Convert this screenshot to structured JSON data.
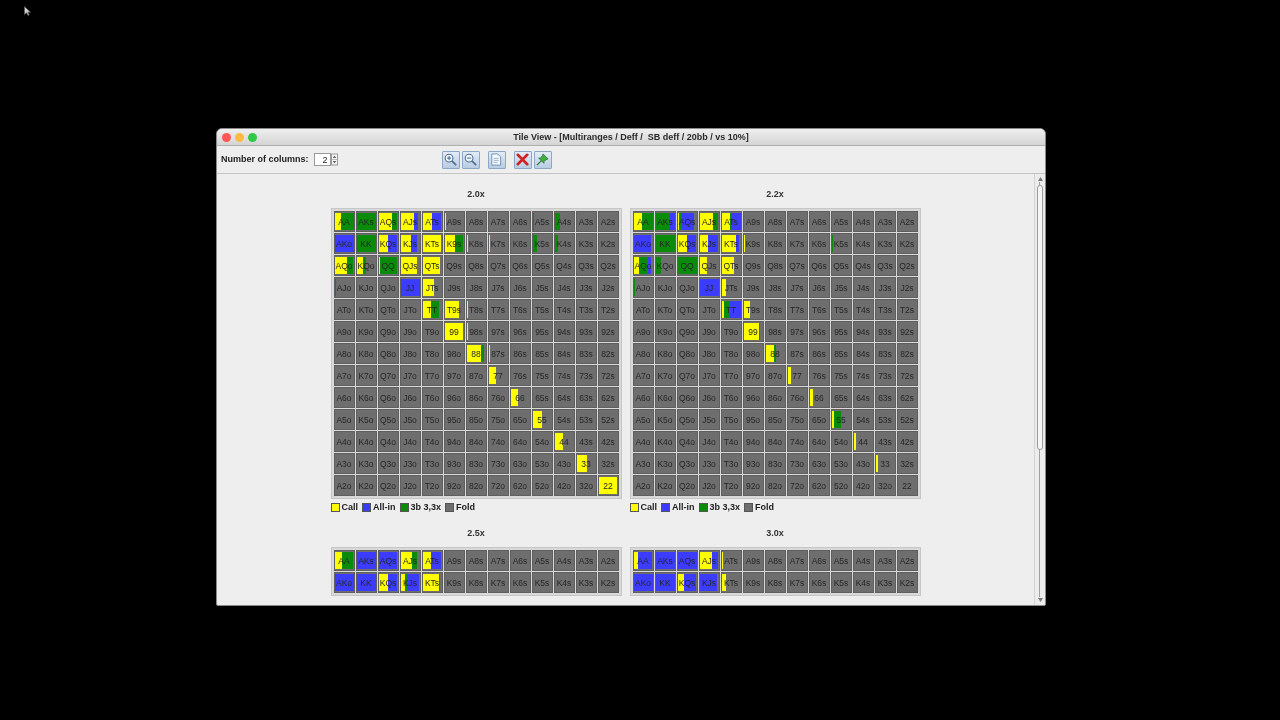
{
  "window": {
    "title": "Tile View - [Multiranges / Deff /  SB deff / 20bb / vs 10%]"
  },
  "toolbar": {
    "columns_label": "Number of columns:",
    "columns_value": "2"
  },
  "tiles": [
    {
      "title": "2.0x",
      "rows": [
        [
          {
            "label": "AA",
            "segments": [
              {
                "color": "#ffff00",
                "level": 0.35
              },
              {
                "color": "#0a8c0a",
                "level": 1
              }
            ]
          },
          {
            "label": "AKs",
            "segments": [
              {
                "color": "#0a8c0a",
                "level": 1
              }
            ]
          },
          {
            "label": "AQs",
            "segments": [
              {
                "color": "#ffff00",
                "level": 0.7
              },
              {
                "color": "#0a8c0a",
                "level": 0.95
              }
            ]
          },
          {
            "label": "AJs",
            "segments": [
              {
                "color": "#ffff00",
                "level": 0.7
              },
              {
                "color": "#3c3cff",
                "level": 0.9
              }
            ]
          },
          {
            "label": "ATs",
            "segments": [
              {
                "color": "#ffff00",
                "level": 0.5
              },
              {
                "color": "#3c3cff",
                "level": 0.95
              }
            ]
          },
          {
            "label": "A9s",
            "segments": [
              {
                "color": "#ffff00",
                "level": 0.1
              }
            ]
          },
          {
            "label": "A8s"
          },
          {
            "label": "A7s"
          },
          {
            "label": "A6s"
          },
          {
            "label": "A5s",
            "segments": [
              {
                "color": "#0a8c0a",
                "level": 0.06
              }
            ]
          },
          {
            "label": "A4s",
            "segments": [
              {
                "color": "#0a8c0a",
                "level": 0.3
              }
            ]
          },
          {
            "label": "A3s"
          },
          {
            "label": "A2s"
          }
        ],
        [
          {
            "label": "AKo",
            "segments": [
              {
                "color": "#3c3cff",
                "level": 1
              }
            ]
          },
          {
            "label": "KK",
            "segments": [
              {
                "color": "#0a8c0a",
                "level": 1
              }
            ]
          },
          {
            "label": "KQs",
            "segments": [
              {
                "color": "#ffff00",
                "level": 0.5
              },
              {
                "color": "#3c3cff",
                "level": 0.95
              }
            ]
          },
          {
            "label": "KJs",
            "segments": [
              {
                "color": "#ffff00",
                "level": 0.55
              },
              {
                "color": "#3c3cff",
                "level": 0.85
              }
            ]
          },
          {
            "label": "KTs",
            "segments": [
              {
                "color": "#ffff00",
                "level": 0.95
              }
            ]
          },
          {
            "label": "K9s",
            "segments": [
              {
                "color": "#ffff00",
                "level": 0.55
              },
              {
                "color": "#0a8c0a",
                "level": 0.95
              }
            ]
          },
          {
            "label": "K8s",
            "segments": [
              {
                "color": "#ffff00",
                "level": 0.06
              }
            ]
          },
          {
            "label": "K7s",
            "segments": [
              {
                "color": "#ffff00",
                "level": 0.04
              }
            ]
          },
          {
            "label": "K6s"
          },
          {
            "label": "K5s",
            "segments": [
              {
                "color": "#0a8c0a",
                "level": 0.25
              }
            ]
          },
          {
            "label": "K4s",
            "segments": [
              {
                "color": "#0a8c0a",
                "level": 0.2
              }
            ]
          },
          {
            "label": "K3s"
          },
          {
            "label": "K2s"
          }
        ],
        [
          {
            "label": "AQo",
            "segments": [
              {
                "color": "#ffff00",
                "level": 0.65
              },
              {
                "color": "#0a8c0a",
                "level": 0.95
              }
            ]
          },
          {
            "label": "KQo",
            "segments": [
              {
                "color": "#ffff00",
                "level": 0.35
              },
              {
                "color": "#0a8c0a",
                "level": 0.5
              }
            ]
          },
          {
            "label": "QQ",
            "segments": [
              {
                "color": "#ffff00",
                "level": 0.05
              },
              {
                "color": "#0a8c0a",
                "level": 0.95
              }
            ]
          },
          {
            "label": "QJs",
            "segments": [
              {
                "color": "#ffff00",
                "level": 0.85
              }
            ]
          },
          {
            "label": "QTs",
            "segments": [
              {
                "color": "#ffff00",
                "level": 0.9
              }
            ]
          },
          {
            "label": "Q9s"
          },
          {
            "label": "Q8s"
          },
          {
            "label": "Q7s"
          },
          {
            "label": "Q6s"
          },
          {
            "label": "Q5s"
          },
          {
            "label": "Q4s"
          },
          {
            "label": "Q3s"
          },
          {
            "label": "Q2s"
          }
        ],
        [
          {
            "label": "AJo",
            "segments": [
              {
                "color": "#0a8c0a",
                "level": 0.1
              }
            ]
          },
          {
            "label": "KJo"
          },
          {
            "label": "QJo"
          },
          {
            "label": "JJ",
            "segments": [
              {
                "color": "#3c3cff",
                "level": 1
              }
            ]
          },
          {
            "label": "JTs",
            "segments": [
              {
                "color": "#ffff00",
                "level": 0.6
              }
            ]
          },
          {
            "label": "J9s"
          },
          {
            "label": "J8s"
          },
          {
            "label": "J7s"
          },
          {
            "label": "J6s"
          },
          {
            "label": "J5s"
          },
          {
            "label": "J4s"
          },
          {
            "label": "J3s"
          },
          {
            "label": "J2s"
          }
        ],
        [
          {
            "label": "ATo"
          },
          {
            "label": "KTo"
          },
          {
            "label": "QTo"
          },
          {
            "label": "JTo"
          },
          {
            "label": "TT",
            "segments": [
              {
                "color": "#ffff00",
                "level": 0.45
              },
              {
                "color": "#0a8c0a",
                "level": 0.85
              }
            ]
          },
          {
            "label": "T9s",
            "segments": [
              {
                "color": "#ffff00",
                "level": 0.75
              }
            ]
          },
          {
            "label": "T8s",
            "segments": [
              {
                "color": "#ffff00",
                "level": 0.06
              }
            ]
          },
          {
            "label": "T7s"
          },
          {
            "label": "T6s"
          },
          {
            "label": "T5s"
          },
          {
            "label": "T4s"
          },
          {
            "label": "T3s"
          },
          {
            "label": "T2s"
          }
        ],
        [
          {
            "label": "A9o"
          },
          {
            "label": "K9o"
          },
          {
            "label": "Q9o"
          },
          {
            "label": "J9o"
          },
          {
            "label": "T9o"
          },
          {
            "label": "99",
            "segments": [
              {
                "color": "#ffff00",
                "level": 0.95
              }
            ]
          },
          {
            "label": "98s",
            "segments": [
              {
                "color": "#ffff00",
                "level": 0.06
              }
            ]
          },
          {
            "label": "97s"
          },
          {
            "label": "96s"
          },
          {
            "label": "95s"
          },
          {
            "label": "94s"
          },
          {
            "label": "93s"
          },
          {
            "label": "92s"
          }
        ],
        [
          {
            "label": "A8o"
          },
          {
            "label": "K8o"
          },
          {
            "label": "Q8o"
          },
          {
            "label": "J8o"
          },
          {
            "label": "T8o"
          },
          {
            "label": "98o"
          },
          {
            "label": "88",
            "segments": [
              {
                "color": "#ffff00",
                "level": 0.75
              },
              {
                "color": "#0a8c0a",
                "level": 0.9
              }
            ]
          },
          {
            "label": "87s",
            "segments": [
              {
                "color": "#ffff00",
                "level": 0.06
              }
            ]
          },
          {
            "label": "86s"
          },
          {
            "label": "85s"
          },
          {
            "label": "84s"
          },
          {
            "label": "83s"
          },
          {
            "label": "82s"
          }
        ],
        [
          {
            "label": "A7o"
          },
          {
            "label": "K7o"
          },
          {
            "label": "Q7o"
          },
          {
            "label": "J7o"
          },
          {
            "label": "T7o"
          },
          {
            "label": "97o"
          },
          {
            "label": "87o"
          },
          {
            "label": "77",
            "segments": [
              {
                "color": "#ffff00",
                "level": 0.4
              }
            ]
          },
          {
            "label": "76s"
          },
          {
            "label": "75s"
          },
          {
            "label": "74s"
          },
          {
            "label": "73s"
          },
          {
            "label": "72s"
          }
        ],
        [
          {
            "label": "A6o"
          },
          {
            "label": "K6o"
          },
          {
            "label": "Q6o"
          },
          {
            "label": "J6o"
          },
          {
            "label": "T6o"
          },
          {
            "label": "96o"
          },
          {
            "label": "86o"
          },
          {
            "label": "76o"
          },
          {
            "label": "66",
            "segments": [
              {
                "color": "#ffff00",
                "level": 0.4
              }
            ]
          },
          {
            "label": "65s"
          },
          {
            "label": "64s"
          },
          {
            "label": "63s"
          },
          {
            "label": "62s"
          }
        ],
        [
          {
            "label": "A5o"
          },
          {
            "label": "K5o"
          },
          {
            "label": "Q5o"
          },
          {
            "label": "J5o"
          },
          {
            "label": "T5o"
          },
          {
            "label": "95o"
          },
          {
            "label": "85o"
          },
          {
            "label": "75o"
          },
          {
            "label": "65o"
          },
          {
            "label": "55",
            "segments": [
              {
                "color": "#ffff00",
                "level": 0.5
              }
            ]
          },
          {
            "label": "54s"
          },
          {
            "label": "53s"
          },
          {
            "label": "52s"
          }
        ],
        [
          {
            "label": "A4o"
          },
          {
            "label": "K4o"
          },
          {
            "label": "Q4o"
          },
          {
            "label": "J4o"
          },
          {
            "label": "T4o"
          },
          {
            "label": "94o"
          },
          {
            "label": "84o"
          },
          {
            "label": "74o"
          },
          {
            "label": "64o"
          },
          {
            "label": "54o"
          },
          {
            "label": "44",
            "segments": [
              {
                "color": "#ffff00",
                "level": 0.45
              }
            ]
          },
          {
            "label": "43s"
          },
          {
            "label": "42s"
          }
        ],
        [
          {
            "label": "A3o"
          },
          {
            "label": "K3o"
          },
          {
            "label": "Q3o"
          },
          {
            "label": "J3o"
          },
          {
            "label": "T3o"
          },
          {
            "label": "93o"
          },
          {
            "label": "83o"
          },
          {
            "label": "73o"
          },
          {
            "label": "63o"
          },
          {
            "label": "53o"
          },
          {
            "label": "43o"
          },
          {
            "label": "33",
            "segments": [
              {
                "color": "#ffff00",
                "level": 0.55
              }
            ]
          },
          {
            "label": "32s"
          }
        ],
        [
          {
            "label": "A2o"
          },
          {
            "label": "K2o"
          },
          {
            "label": "Q2o"
          },
          {
            "label": "J2o"
          },
          {
            "label": "T2o"
          },
          {
            "label": "92o"
          },
          {
            "label": "82o"
          },
          {
            "label": "72o"
          },
          {
            "label": "62o"
          },
          {
            "label": "52o"
          },
          {
            "label": "42o"
          },
          {
            "label": "32o"
          },
          {
            "label": "22",
            "segments": [
              {
                "color": "#ffff00",
                "level": 0.95
              }
            ]
          }
        ]
      ],
      "legend": [
        {
          "label": "Call",
          "color": "#ffff00"
        },
        {
          "label": "All-in",
          "color": "#3c3cff"
        },
        {
          "label": "3b 3,3x",
          "color": "#0a8c0a"
        },
        {
          "label": "Fold",
          "color": "#6e6e6e"
        }
      ]
    },
    {
      "title": "2.2x",
      "rows": [
        [
          {
            "label": "AA",
            "segments": [
              {
                "color": "#ffff00",
                "level": 0.45
              },
              {
                "color": "#0a8c0a",
                "level": 1
              }
            ]
          },
          {
            "label": "AKs",
            "segments": [
              {
                "color": "#0a8c0a",
                "level": 0.7
              },
              {
                "color": "#3c3cff",
                "level": 1
              }
            ]
          },
          {
            "label": "AQs",
            "segments": [
              {
                "color": "#ffff00",
                "level": 0.1
              },
              {
                "color": "#0a8c0a",
                "level": 0.25
              },
              {
                "color": "#3c3cff",
                "level": 0.85
              }
            ]
          },
          {
            "label": "AJs",
            "segments": [
              {
                "color": "#ffff00",
                "level": 0.7
              },
              {
                "color": "#0a8c0a",
                "level": 0.95
              }
            ]
          },
          {
            "label": "ATs",
            "segments": [
              {
                "color": "#ffff00",
                "level": 0.45
              },
              {
                "color": "#0a8c0a",
                "level": 0.55
              },
              {
                "color": "#3c3cff",
                "level": 1
              }
            ]
          },
          {
            "label": "A9s"
          },
          {
            "label": "A8s"
          },
          {
            "label": "A7s"
          },
          {
            "label": "A6s"
          },
          {
            "label": "A5s"
          },
          {
            "label": "A4s"
          },
          {
            "label": "A3s"
          },
          {
            "label": "A2s"
          }
        ],
        [
          {
            "label": "AKo",
            "segments": [
              {
                "color": "#3c3cff",
                "level": 0.9
              }
            ]
          },
          {
            "label": "KK",
            "segments": [
              {
                "color": "#0a8c0a",
                "level": 1
              }
            ]
          },
          {
            "label": "KQs",
            "segments": [
              {
                "color": "#ffff00",
                "level": 0.5
              },
              {
                "color": "#3c3cff",
                "level": 0.95
              }
            ]
          },
          {
            "label": "KJs",
            "segments": [
              {
                "color": "#ffff00",
                "level": 0.45
              },
              {
                "color": "#3c3cff",
                "level": 0.95
              }
            ]
          },
          {
            "label": "KTs",
            "segments": [
              {
                "color": "#ffff00",
                "level": 0.75
              },
              {
                "color": "#3c3cff",
                "level": 0.9
              }
            ]
          },
          {
            "label": "K9s",
            "segments": [
              {
                "color": "#ffff00",
                "level": 0.1
              }
            ]
          },
          {
            "label": "K8s"
          },
          {
            "label": "K7s"
          },
          {
            "label": "K6s"
          },
          {
            "label": "K5s",
            "segments": [
              {
                "color": "#0a8c0a",
                "level": 0.06
              }
            ]
          },
          {
            "label": "K4s"
          },
          {
            "label": "K3s"
          },
          {
            "label": "K2s"
          }
        ],
        [
          {
            "label": "AQo",
            "segments": [
              {
                "color": "#ffff00",
                "level": 0.3
              },
              {
                "color": "#0a8c0a",
                "level": 0.75
              },
              {
                "color": "#3c3cff",
                "level": 0.9
              }
            ]
          },
          {
            "label": "KQo",
            "segments": [
              {
                "color": "#0a8c0a",
                "level": 0.3
              }
            ]
          },
          {
            "label": "QQ",
            "segments": [
              {
                "color": "#0a8c0a",
                "level": 1
              }
            ]
          },
          {
            "label": "QJs",
            "segments": [
              {
                "color": "#ffff00",
                "level": 0.4
              }
            ]
          },
          {
            "label": "QTs",
            "segments": [
              {
                "color": "#ffff00",
                "level": 0.65
              }
            ]
          },
          {
            "label": "Q9s"
          },
          {
            "label": "Q8s"
          },
          {
            "label": "Q7s"
          },
          {
            "label": "Q6s"
          },
          {
            "label": "Q5s"
          },
          {
            "label": "Q4s"
          },
          {
            "label": "Q3s"
          },
          {
            "label": "Q2s"
          }
        ],
        [
          {
            "label": "AJo",
            "segments": [
              {
                "color": "#0a8c0a",
                "level": 0.08
              }
            ]
          },
          {
            "label": "KJo"
          },
          {
            "label": "QJo"
          },
          {
            "label": "JJ",
            "segments": [
              {
                "color": "#3c3cff",
                "level": 1
              }
            ]
          },
          {
            "label": "JTs",
            "segments": [
              {
                "color": "#ffff00",
                "level": 0.25
              }
            ]
          },
          {
            "label": "J9s"
          },
          {
            "label": "J8s"
          },
          {
            "label": "J7s"
          },
          {
            "label": "J6s"
          },
          {
            "label": "J5s"
          },
          {
            "label": "J4s"
          },
          {
            "label": "J3s"
          },
          {
            "label": "J2s"
          }
        ],
        [
          {
            "label": "ATo"
          },
          {
            "label": "KTo"
          },
          {
            "label": "QTo"
          },
          {
            "label": "JTo"
          },
          {
            "label": "TT",
            "segments": [
              {
                "color": "#ffff00",
                "level": 0.15
              },
              {
                "color": "#0a8c0a",
                "level": 0.45
              },
              {
                "color": "#3c3cff",
                "level": 1
              }
            ]
          },
          {
            "label": "T9s",
            "segments": [
              {
                "color": "#ffff00",
                "level": 0.35
              }
            ]
          },
          {
            "label": "T8s"
          },
          {
            "label": "T7s"
          },
          {
            "label": "T6s"
          },
          {
            "label": "T5s"
          },
          {
            "label": "T4s"
          },
          {
            "label": "T3s"
          },
          {
            "label": "T2s"
          }
        ],
        [
          {
            "label": "A9o"
          },
          {
            "label": "K9o"
          },
          {
            "label": "Q9o"
          },
          {
            "label": "J9o"
          },
          {
            "label": "T9o"
          },
          {
            "label": "99",
            "segments": [
              {
                "color": "#ffff00",
                "level": 0.8
              },
              {
                "color": "#0a8c0a",
                "level": 0.85
              }
            ]
          },
          {
            "label": "98s"
          },
          {
            "label": "97s"
          },
          {
            "label": "96s"
          },
          {
            "label": "95s"
          },
          {
            "label": "94s"
          },
          {
            "label": "93s"
          },
          {
            "label": "92s"
          }
        ],
        [
          {
            "label": "A8o"
          },
          {
            "label": "K8o"
          },
          {
            "label": "Q8o"
          },
          {
            "label": "J8o"
          },
          {
            "label": "T8o"
          },
          {
            "label": "98o"
          },
          {
            "label": "88",
            "segments": [
              {
                "color": "#ffff00",
                "level": 0.45
              },
              {
                "color": "#0a8c0a",
                "level": 0.55
              }
            ]
          },
          {
            "label": "87s"
          },
          {
            "label": "86s"
          },
          {
            "label": "85s"
          },
          {
            "label": "84s"
          },
          {
            "label": "83s"
          },
          {
            "label": "82s"
          }
        ],
        [
          {
            "label": "A7o"
          },
          {
            "label": "K7o"
          },
          {
            "label": "Q7o"
          },
          {
            "label": "J7o"
          },
          {
            "label": "T7o"
          },
          {
            "label": "97o"
          },
          {
            "label": "87o"
          },
          {
            "label": "77",
            "segments": [
              {
                "color": "#ffff00",
                "level": 0.2
              }
            ]
          },
          {
            "label": "76s"
          },
          {
            "label": "75s"
          },
          {
            "label": "74s"
          },
          {
            "label": "73s"
          },
          {
            "label": "72s"
          }
        ],
        [
          {
            "label": "A6o"
          },
          {
            "label": "K6o"
          },
          {
            "label": "Q6o"
          },
          {
            "label": "J6o"
          },
          {
            "label": "T6o"
          },
          {
            "label": "96o"
          },
          {
            "label": "86o"
          },
          {
            "label": "76o"
          },
          {
            "label": "66",
            "segments": [
              {
                "color": "#ffff00",
                "level": 0.2
              }
            ]
          },
          {
            "label": "65s"
          },
          {
            "label": "64s"
          },
          {
            "label": "63s"
          },
          {
            "label": "62s"
          }
        ],
        [
          {
            "label": "A5o"
          },
          {
            "label": "K5o"
          },
          {
            "label": "Q5o"
          },
          {
            "label": "J5o"
          },
          {
            "label": "T5o"
          },
          {
            "label": "95o"
          },
          {
            "label": "85o"
          },
          {
            "label": "75o"
          },
          {
            "label": "65o"
          },
          {
            "label": "55",
            "segments": [
              {
                "color": "#ffff00",
                "level": 0.15
              },
              {
                "color": "#0a8c0a",
                "level": 0.5
              }
            ]
          },
          {
            "label": "54s"
          },
          {
            "label": "53s"
          },
          {
            "label": "52s"
          }
        ],
        [
          {
            "label": "A4o"
          },
          {
            "label": "K4o"
          },
          {
            "label": "Q4o"
          },
          {
            "label": "J4o"
          },
          {
            "label": "T4o"
          },
          {
            "label": "94o"
          },
          {
            "label": "84o"
          },
          {
            "label": "74o"
          },
          {
            "label": "64o"
          },
          {
            "label": "54o"
          },
          {
            "label": "44",
            "segments": [
              {
                "color": "#ffff00",
                "level": 0.15
              }
            ]
          },
          {
            "label": "43s"
          },
          {
            "label": "42s"
          }
        ],
        [
          {
            "label": "A3o"
          },
          {
            "label": "K3o"
          },
          {
            "label": "Q3o"
          },
          {
            "label": "J3o"
          },
          {
            "label": "T3o"
          },
          {
            "label": "93o"
          },
          {
            "label": "83o"
          },
          {
            "label": "73o"
          },
          {
            "label": "63o"
          },
          {
            "label": "53o"
          },
          {
            "label": "43o"
          },
          {
            "label": "33",
            "segments": [
              {
                "color": "#ffff00",
                "level": 0.15
              }
            ]
          },
          {
            "label": "32s"
          }
        ],
        [
          {
            "label": "A2o"
          },
          {
            "label": "K2o"
          },
          {
            "label": "Q2o"
          },
          {
            "label": "J2o"
          },
          {
            "label": "T2o"
          },
          {
            "label": "92o"
          },
          {
            "label": "82o"
          },
          {
            "label": "72o"
          },
          {
            "label": "62o"
          },
          {
            "label": "52o"
          },
          {
            "label": "42o"
          },
          {
            "label": "32o"
          },
          {
            "label": "22"
          }
        ]
      ],
      "legend": [
        {
          "label": "Call",
          "color": "#ffff00"
        },
        {
          "label": "All-in",
          "color": "#3c3cff"
        },
        {
          "label": "3b 3,3x",
          "color": "#0a8c0a"
        },
        {
          "label": "Fold",
          "color": "#6e6e6e"
        }
      ]
    },
    {
      "title": "2.5x",
      "rows": [
        [
          {
            "label": "AA",
            "segments": [
              {
                "color": "#ffff00",
                "level": 0.4
              },
              {
                "color": "#0a8c0a",
                "level": 0.95
              }
            ]
          },
          {
            "label": "AKs",
            "segments": [
              {
                "color": "#3c3cff",
                "level": 1
              }
            ]
          },
          {
            "label": "AQs",
            "segments": [
              {
                "color": "#0a8c0a",
                "level": 0.1
              },
              {
                "color": "#3c3cff",
                "level": 0.95
              }
            ]
          },
          {
            "label": "AJs",
            "segments": [
              {
                "color": "#ffff00",
                "level": 0.6
              },
              {
                "color": "#0a8c0a",
                "level": 0.85
              }
            ]
          },
          {
            "label": "ATs",
            "segments": [
              {
                "color": "#ffff00",
                "level": 0.45
              },
              {
                "color": "#3c3cff",
                "level": 0.95
              }
            ]
          },
          {
            "label": "A9s"
          },
          {
            "label": "A8s"
          },
          {
            "label": "A7s"
          },
          {
            "label": "A6s"
          },
          {
            "label": "A5s"
          },
          {
            "label": "A4s"
          },
          {
            "label": "A3s"
          },
          {
            "label": "A2s"
          }
        ],
        [
          {
            "label": "AKo",
            "segments": [
              {
                "color": "#3c3cff",
                "level": 1
              }
            ]
          },
          {
            "label": "KK",
            "segments": [
              {
                "color": "#0a8c0a",
                "level": 0.1
              },
              {
                "color": "#3c3cff",
                "level": 1
              }
            ]
          },
          {
            "label": "KQs",
            "segments": [
              {
                "color": "#ffff00",
                "level": 0.5
              },
              {
                "color": "#3c3cff",
                "level": 0.95
              }
            ]
          },
          {
            "label": "KJs",
            "segments": [
              {
                "color": "#ffff00",
                "level": 0.25
              },
              {
                "color": "#0a8c0a",
                "level": 0.4
              },
              {
                "color": "#3c3cff",
                "level": 0.95
              }
            ]
          },
          {
            "label": "KTs",
            "segments": [
              {
                "color": "#ffff00",
                "level": 0.85
              },
              {
                "color": "#0a8c0a",
                "level": 0.9
              }
            ]
          },
          {
            "label": "K9s"
          },
          {
            "label": "K8s"
          },
          {
            "label": "K7s"
          },
          {
            "label": "K6s"
          },
          {
            "label": "K5s"
          },
          {
            "label": "K4s"
          },
          {
            "label": "K3s"
          },
          {
            "label": "K2s"
          }
        ]
      ]
    },
    {
      "title": "3.0x",
      "rows": [
        [
          {
            "label": "AA",
            "segments": [
              {
                "color": "#ffff00",
                "level": 0.25
              },
              {
                "color": "#3c3cff",
                "level": 0.95
              }
            ]
          },
          {
            "label": "AKs",
            "segments": [
              {
                "color": "#3c3cff",
                "level": 1
              }
            ]
          },
          {
            "label": "AQs",
            "segments": [
              {
                "color": "#3c3cff",
                "level": 1
              }
            ]
          },
          {
            "label": "AJs",
            "segments": [
              {
                "color": "#ffff00",
                "level": 0.65
              },
              {
                "color": "#3c3cff",
                "level": 0.95
              }
            ]
          },
          {
            "label": "ATs",
            "segments": [
              {
                "color": "#ffff00",
                "level": 0.06
              }
            ]
          },
          {
            "label": "A9s"
          },
          {
            "label": "A8s"
          },
          {
            "label": "A7s"
          },
          {
            "label": "A6s"
          },
          {
            "label": "A5s"
          },
          {
            "label": "A4s"
          },
          {
            "label": "A3s"
          },
          {
            "label": "A2s"
          }
        ],
        [
          {
            "label": "AKo",
            "segments": [
              {
                "color": "#3c3cff",
                "level": 1
              }
            ]
          },
          {
            "label": "KK",
            "segments": [
              {
                "color": "#3c3cff",
                "level": 1
              }
            ]
          },
          {
            "label": "KQs",
            "segments": [
              {
                "color": "#ffff00",
                "level": 0.35
              },
              {
                "color": "#3c3cff",
                "level": 0.95
              }
            ]
          },
          {
            "label": "KJs",
            "segments": [
              {
                "color": "#3c3cff",
                "level": 0.9
              }
            ]
          },
          {
            "label": "KTs",
            "segments": [
              {
                "color": "#ffff00",
                "level": 0.25
              }
            ]
          },
          {
            "label": "K9s"
          },
          {
            "label": "K8s"
          },
          {
            "label": "K7s"
          },
          {
            "label": "K6s"
          },
          {
            "label": "K5s"
          },
          {
            "label": "K4s"
          },
          {
            "label": "K3s"
          },
          {
            "label": "K2s"
          }
        ]
      ]
    }
  ]
}
